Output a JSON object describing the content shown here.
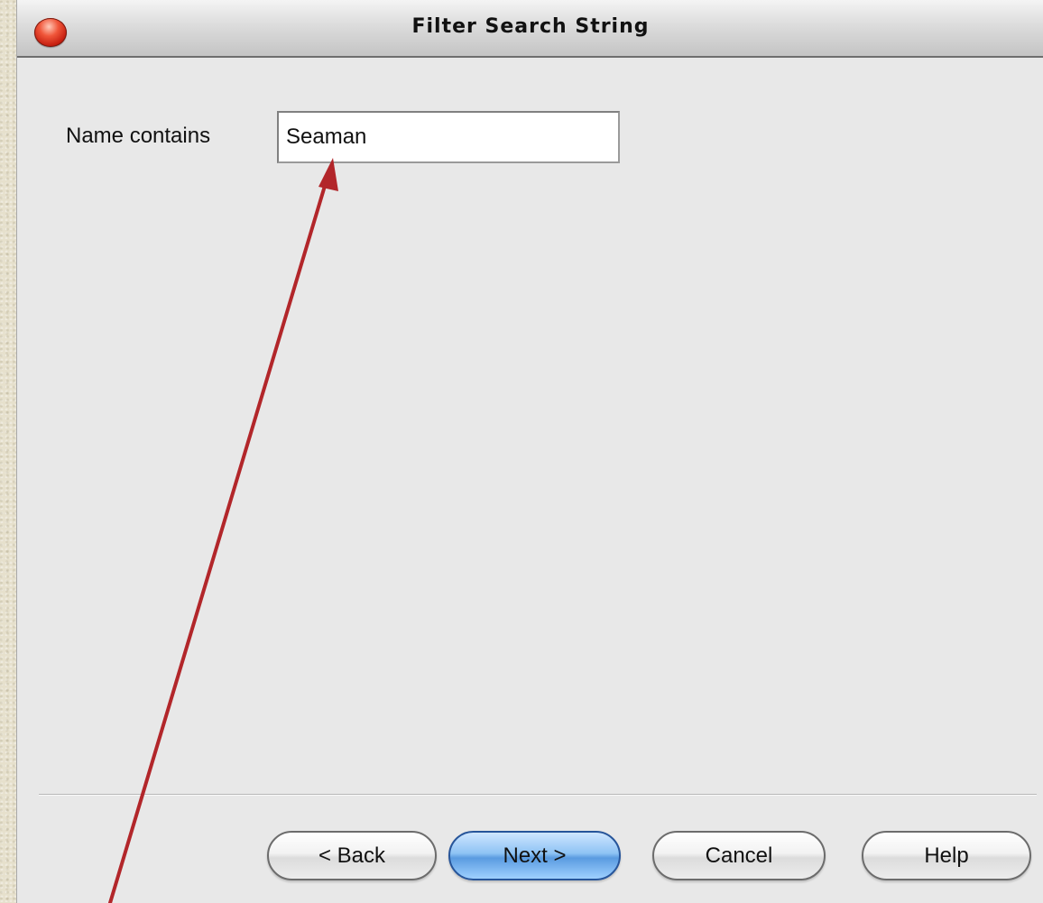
{
  "window": {
    "title": "Filter Search String",
    "close_icon": "close-icon",
    "accent_colors": {
      "close_button": "#d92b16",
      "primary_button": "#5a9be0",
      "annotation_arrow": "#b2262a"
    }
  },
  "form": {
    "name_contains_label": "Name contains",
    "name_contains_value": "Seaman"
  },
  "buttons": {
    "back": "< Back",
    "next": "Next >",
    "cancel": "Cancel",
    "help": "Help"
  },
  "annotation": {
    "type": "arrow",
    "points_to": "name-contains-input"
  }
}
